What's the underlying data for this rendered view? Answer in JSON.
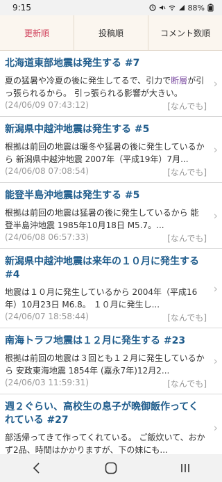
{
  "status": {
    "time": "9:15",
    "battery": "88%"
  },
  "tabs": [
    {
      "label": "更新順",
      "active": true
    },
    {
      "label": "投稿順",
      "active": false
    },
    {
      "label": "コメント数順",
      "active": false
    }
  ],
  "posts": [
    {
      "title": "北海道東部地震は発生する #7",
      "body_prefix": "夏の猛暑や冷夏の後に発生してるで、引力で",
      "body_highlight": "断層",
      "body_suffix": "が引っ張られるから。 引っ張られる影響が大きい。",
      "date": "(24/06/09 07:43:12)",
      "category": "[なんでも]"
    },
    {
      "title": "新潟県中越沖地震は発生する #5",
      "body_prefix": "根拠は前回の地震は暖冬や猛暑の後に発生しているから 新潟県中越沖地震 2007年（平成19年）7月...",
      "body_highlight": "",
      "body_suffix": "",
      "date": "(24/06/08 07:08:54)",
      "category": "[なんでも]"
    },
    {
      "title": "能登半島沖地震は発生する #5",
      "body_prefix": "根拠は前回の地震は猛暑の後に発生しているから 能登半島沖地震 1985年10月18日 M5.7。...",
      "body_highlight": "",
      "body_suffix": "",
      "date": "(24/06/08 06:57:33)",
      "category": "[なんでも]"
    },
    {
      "title": "新潟県中越沖地震は来年の１０月に発生する #4",
      "body_prefix": "地震は１０月に発生しているから 2004年（平成16年）10月23日 M6.8。 １０月に発生し...",
      "body_highlight": "",
      "body_suffix": "",
      "date": "(24/06/07 18:58:44)",
      "category": "[なんでも]"
    },
    {
      "title": "南海トラフ地震は１２月に発生する #23",
      "body_prefix": "根拠は前回の地震は３回とも１２月に発生しているから 安政東海地震 1854年 (嘉永7年)12月2...",
      "body_highlight": "",
      "body_suffix": "",
      "date": "(24/06/03 11:59:31)",
      "category": "[なんでも]"
    },
    {
      "title": "週２ぐらい、高校生の息子が晩御飯作ってくれている #27",
      "body_prefix": "部活帰ってきて作ってくれている。 ご飯炊いて、おかず2品、時間はかかりますが、下の妹にも...",
      "body_highlight": "",
      "body_suffix": "",
      "date": "",
      "category": ""
    }
  ]
}
